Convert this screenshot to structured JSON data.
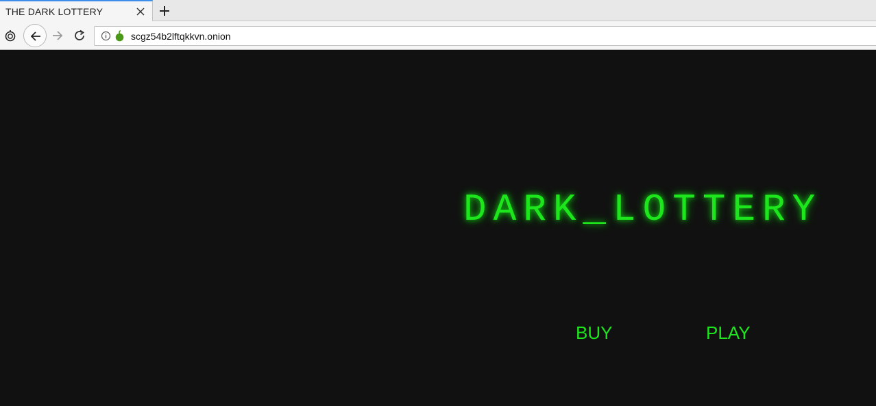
{
  "browser": {
    "tab": {
      "title": "THE DARK LOTTERY"
    },
    "url": "scgz54b2lftqkkvn.onion",
    "icons": {
      "tab_close": "close-icon",
      "new_tab": "plus-icon",
      "tor_button": "onion-icon",
      "back": "arrow-left-icon",
      "forward": "arrow-right-icon",
      "reload": "reload-icon",
      "site_info": "info-icon",
      "onion_indicator": "onion-icon"
    }
  },
  "page": {
    "title": "DARK_LOTTERY",
    "links": {
      "buy": "BUY",
      "play": "PLAY"
    },
    "colors": {
      "background": "#111111",
      "accent": "#1de61d"
    }
  }
}
